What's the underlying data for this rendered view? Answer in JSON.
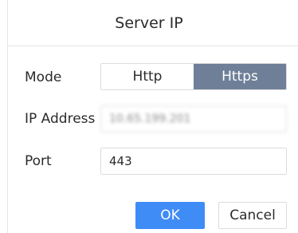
{
  "dialog": {
    "title": "Server IP"
  },
  "form": {
    "mode": {
      "label": "Mode",
      "options": [
        "Http",
        "Https"
      ],
      "selected": "Https"
    },
    "ip_address": {
      "label": "IP Address",
      "value": "10.65.199.201"
    },
    "port": {
      "label": "Port",
      "value": "443"
    }
  },
  "actions": {
    "ok_label": "OK",
    "cancel_label": "Cancel"
  },
  "colors": {
    "primary_button": "#3f8cf7",
    "segment_active": "#6f7f98",
    "border": "#dcdcdc"
  }
}
